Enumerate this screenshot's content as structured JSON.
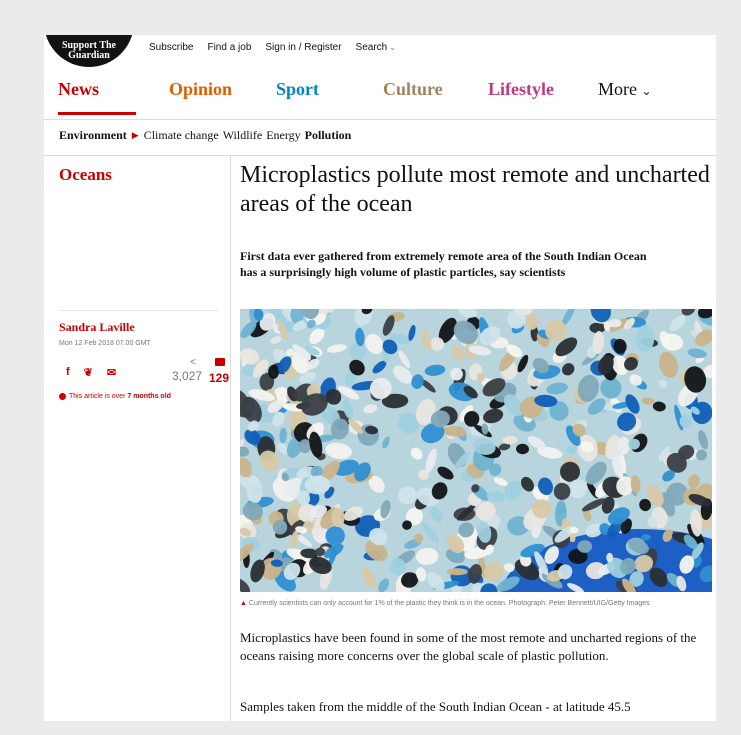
{
  "masthead": {
    "support_line1": "Support The",
    "support_line2": "Guardian",
    "links": [
      "Subscribe",
      "Find a job",
      "Sign in / Register",
      "Search"
    ]
  },
  "pillars": [
    {
      "label": "News",
      "color": "#c70000",
      "active": true
    },
    {
      "label": "Opinion",
      "color": "#e05e00"
    },
    {
      "label": "Sport",
      "color": "#0084c6"
    },
    {
      "label": "Culture",
      "color": "#a1845c"
    },
    {
      "label": "Lifestyle",
      "color": "#bb3b80"
    },
    {
      "label": "More",
      "color": "#121212"
    }
  ],
  "subnav": {
    "section": "Environment",
    "items": [
      "Climate change",
      "Wildlife",
      "Energy",
      "Pollution"
    ],
    "current": "Pollution"
  },
  "article": {
    "section_label": "Oceans",
    "headline": "Microplastics pollute most remote and uncharted areas of the ocean",
    "standfirst": "First data ever gathered from extremely remote area of the South Indian Ocean has a surprisingly high volume of plastic particles, say scientists",
    "author": "Sandra Laville",
    "date": "Mon 12 Feb 2018 07.00 GMT",
    "share_count": "3,027",
    "comment_count": "129",
    "age_prefix": "This article is over ",
    "age_value": "7 months old",
    "caption": "Currently scientists can only account for 1% of the plastic they think is in the ocean. Photograph: Peter Bennett/UIG/Getty Images",
    "body1": "Microplastics have been found in some of the most remote and uncharted regions of the oceans raising more concerns over the global scale of plastic pollution.",
    "body2": "Samples taken from the middle of the South Indian Ocean - at latitude 45.5"
  },
  "colors": {
    "accent": "#c70000",
    "background": "#ebebeb"
  }
}
